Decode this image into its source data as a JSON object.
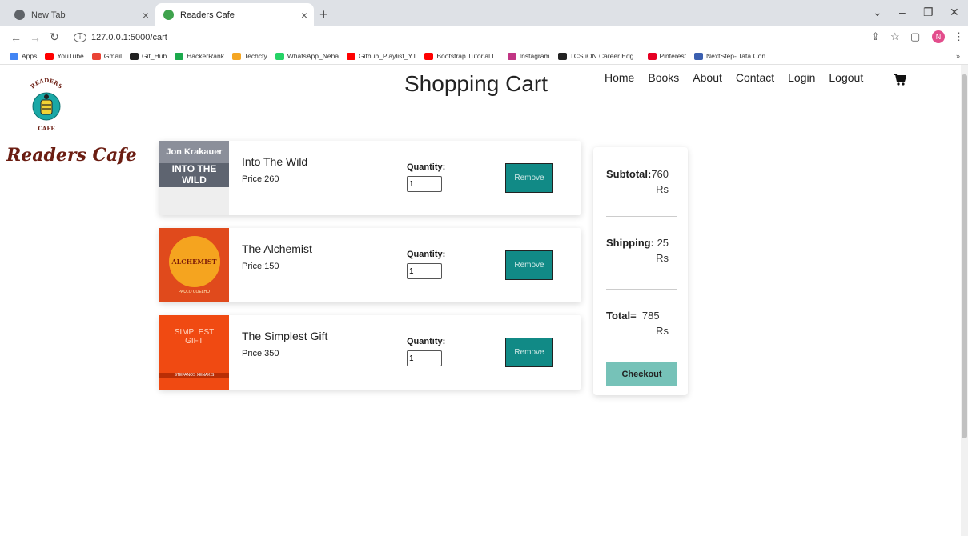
{
  "browser": {
    "tabs": [
      {
        "title": "New Tab",
        "close": "×"
      },
      {
        "title": "Readers Cafe",
        "close": "×"
      }
    ],
    "new_tab": "+",
    "url": "127.0.0.1:5000/cart",
    "profile_initial": "N",
    "bookmarks": [
      {
        "label": "Apps",
        "color": "#4285f4"
      },
      {
        "label": "YouTube",
        "color": "#ff0000"
      },
      {
        "label": "Gmail",
        "color": "#ea4335"
      },
      {
        "label": "Git_Hub",
        "color": "#222222"
      },
      {
        "label": "HackerRank",
        "color": "#1ba94c"
      },
      {
        "label": "Techcty",
        "color": "#f5a623"
      },
      {
        "label": "WhatsApp_Neha",
        "color": "#25d366"
      },
      {
        "label": "Github_Playlist_YT",
        "color": "#ff0000"
      },
      {
        "label": "Bootstrap Tutorial I...",
        "color": "#ff0000"
      },
      {
        "label": "Instagram",
        "color": "#c13584"
      },
      {
        "label": "TCS iON Career Edg...",
        "color": "#222222"
      },
      {
        "label": "Pinterest",
        "color": "#e60023"
      },
      {
        "label": "NextStep- Tata Con...",
        "color": "#3b5fb0"
      }
    ],
    "bookmarks_more": "»"
  },
  "site": {
    "brand": "Readers Cafe",
    "logo_top_text": "READERS",
    "logo_bottom_text": "CAFE",
    "page_title": "Shopping Cart",
    "nav": [
      "Home",
      "Books",
      "About",
      "Contact",
      "Login",
      "Logout"
    ]
  },
  "cart": {
    "quantity_label": "Quantity:",
    "remove_label": "Remove",
    "items": [
      {
        "name": "Into The Wild",
        "price": "Price:260",
        "qty": "1",
        "cover_author": "Jon Krakauer",
        "cover_title": "INTO THE WILD",
        "cover_color": "#8b8f9a"
      },
      {
        "name": "The Alchemist",
        "price": "Price:150",
        "qty": "1",
        "cover_title": "ALCHEMIST",
        "cover_author": "PAULO COELHO",
        "cover_color": "#e04a1c"
      },
      {
        "name": "The Simplest Gift",
        "price": "Price:350",
        "qty": "1",
        "cover_title": "SIMPLEST GIFT",
        "cover_author": "STEFANOS XENAKIS",
        "cover_color": "#f04a12"
      }
    ]
  },
  "summary": {
    "subtotal_label": "Subtotal:",
    "subtotal_value": "760",
    "shipping_label": "Shipping:",
    "shipping_value": "25",
    "total_label": "Total=",
    "total_value": "785",
    "currency": "Rs",
    "checkout_label": "Checkout"
  },
  "colors": {
    "remove_bg": "#118a86",
    "checkout_bg": "#76c2b8",
    "brand": "#6b1d12"
  }
}
